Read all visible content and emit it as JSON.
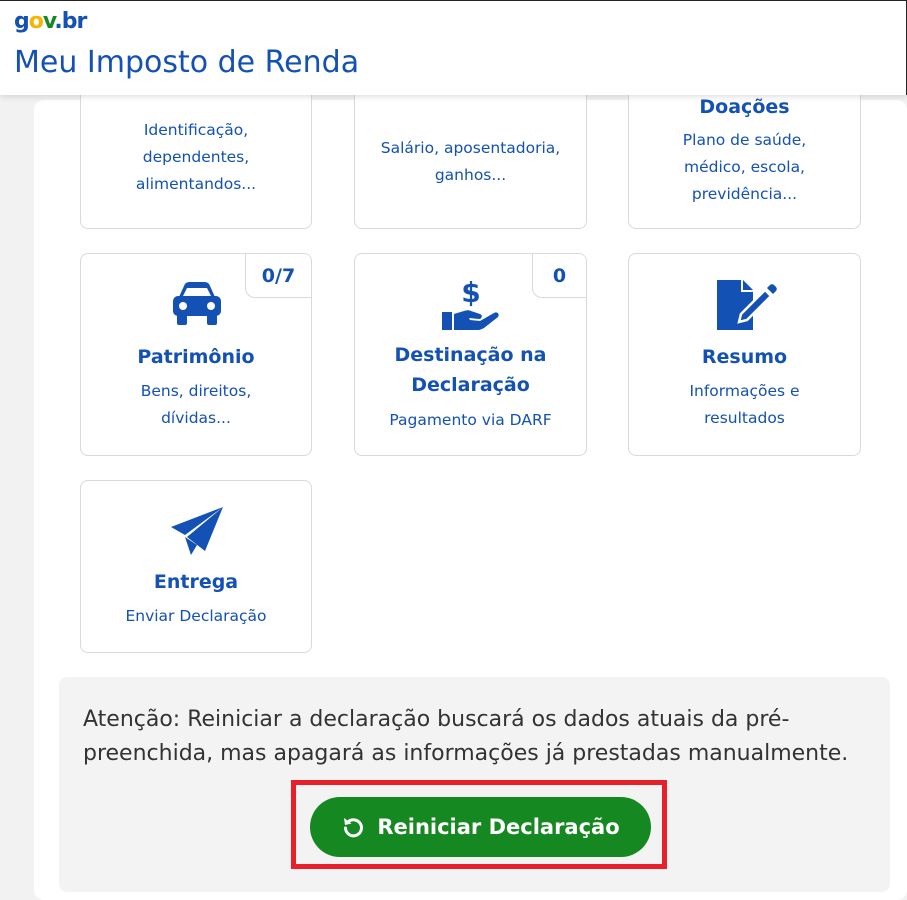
{
  "header": {
    "logo": {
      "g": "g",
      "o": "o",
      "v": "v",
      "dot": ".",
      "b": "b",
      "r": "r"
    },
    "app_title": "Meu Imposto de Renda"
  },
  "cards": {
    "identificacao": {
      "desc": "Identificação, dependentes, alimentandos..."
    },
    "rendimentos": {
      "desc": "Salário, aposentadoria, ganhos..."
    },
    "doacoes": {
      "title": "Doações",
      "desc": "Plano de saúde, médico, escola, previdência..."
    },
    "patrimonio": {
      "title": "Patrimônio",
      "desc": "Bens, direitos, dívidas...",
      "badge": "0/7",
      "icon": "car-icon"
    },
    "destinacao": {
      "title": "Destinação na Declaração",
      "desc": "Pagamento via DARF",
      "badge": "0",
      "icon": "money-hand-icon"
    },
    "resumo": {
      "title": "Resumo",
      "desc": "Informações e resultados",
      "icon": "document-edit-icon"
    },
    "entrega": {
      "title": "Entrega",
      "desc": "Enviar Declaração",
      "icon": "paper-plane-icon"
    }
  },
  "warning": {
    "text": "Atenção: Reiniciar a declaração buscará os dados atuais da pré-preenchida, mas apagará as informações já prestadas manualmente."
  },
  "restart_button": {
    "label": "Reiniciar Declaração",
    "icon": "restart-icon"
  },
  "colors": {
    "brand_blue": "#1351b4",
    "button_green": "#168821",
    "highlight_red": "#e8202a"
  }
}
